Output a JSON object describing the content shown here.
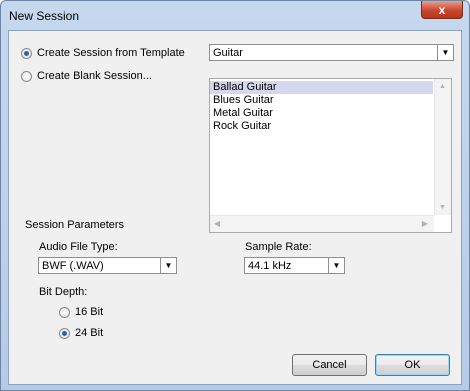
{
  "window": {
    "title": "New Session",
    "close_glyph": "x"
  },
  "session_mode": {
    "from_template_label": "Create Session from Template",
    "blank_label": "Create Blank Session...",
    "selected": "template"
  },
  "template_group": {
    "value": "Guitar"
  },
  "template_list": {
    "items": [
      "Ballad Guitar",
      "Blues Guitar",
      "Metal Guitar",
      "Rock Guitar"
    ],
    "selected_index": 0
  },
  "params": {
    "heading": "Session Parameters",
    "audio_file_type": {
      "label": "Audio File Type:",
      "value": "BWF (.WAV)"
    },
    "sample_rate": {
      "label": "Sample Rate:",
      "value": "44.1 kHz"
    },
    "bit_depth": {
      "label": "Bit Depth:",
      "options": [
        "16 Bit",
        "24 Bit"
      ],
      "selected_index": 1
    }
  },
  "buttons": {
    "cancel": "Cancel",
    "ok": "OK"
  },
  "icons": {
    "dropdown": "chevron-down-icon",
    "close": "close-icon"
  }
}
